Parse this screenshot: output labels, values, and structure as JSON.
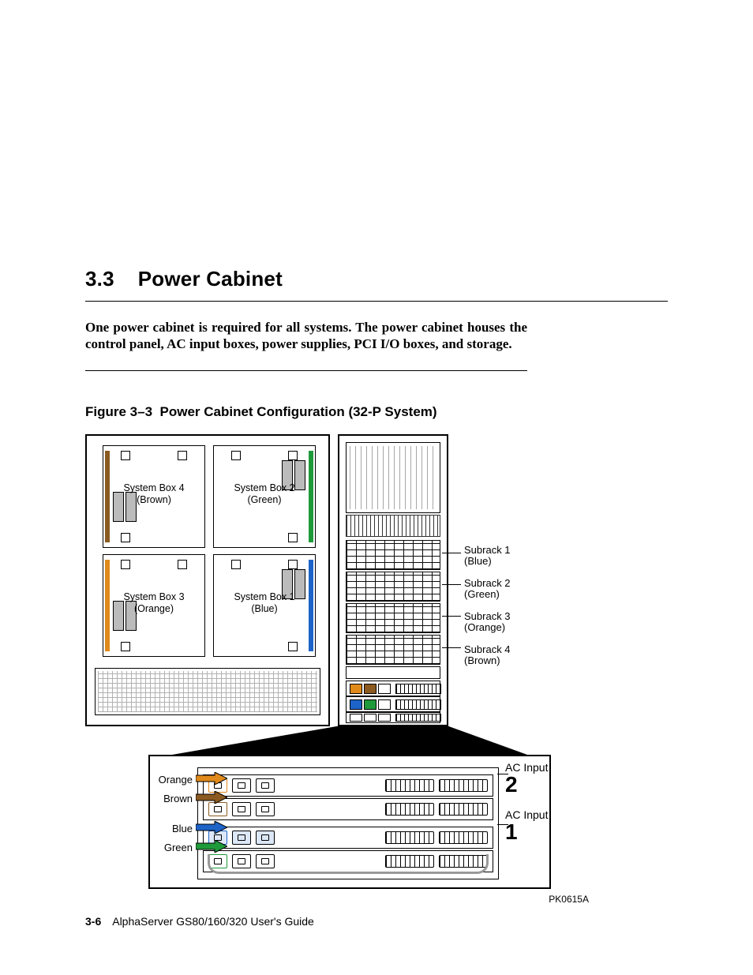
{
  "section": {
    "number": "3.3",
    "title": "Power Cabinet"
  },
  "intro": "One power cabinet is required for all systems.  The power cabinet houses the control panel, AC input boxes, power supplies, PCI I/O boxes, and storage.",
  "figure": {
    "label": "Figure 3–3",
    "title": "Power Cabinet Configuration (32-P System)",
    "code": "PK0615A"
  },
  "system_boxes": [
    {
      "name": "System Box 4",
      "color": "Brown",
      "pos": "top-left"
    },
    {
      "name": "System Box 2",
      "color": "Green",
      "pos": "top-right"
    },
    {
      "name": "System Box 3",
      "color": "Orange",
      "pos": "bottom-left"
    },
    {
      "name": "System Box 1",
      "color": "Blue",
      "pos": "bottom-right"
    }
  ],
  "subracks": [
    {
      "name": "Subrack 1",
      "color": "Blue"
    },
    {
      "name": "Subrack 2",
      "color": "Green"
    },
    {
      "name": "Subrack 3",
      "color": "Orange"
    },
    {
      "name": "Subrack 4",
      "color": "Brown"
    }
  ],
  "ac_inputs": [
    {
      "label": "AC Input",
      "number": "2"
    },
    {
      "label": "AC Input",
      "number": "1"
    }
  ],
  "color_key": [
    "Orange",
    "Brown",
    "Blue",
    "Green"
  ],
  "colors": {
    "Orange": "#e08a1a",
    "Brown": "#8a5a20",
    "Blue": "#1e64c8",
    "Green": "#1f9a3a"
  },
  "footer": {
    "page": "3-6",
    "book": "AlphaServer GS80/160/320 User's Guide"
  }
}
